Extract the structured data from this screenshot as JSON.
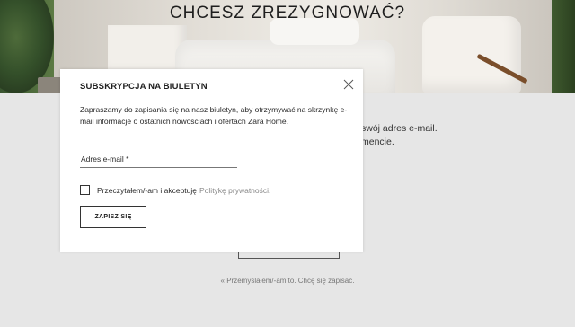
{
  "hero": {
    "title": "CHCESZ ZREZYGNOWAĆ?"
  },
  "background_page": {
    "line1": "swój adres e-mail.",
    "line2": "mencie.",
    "back_link": "« Przemyślałem/-am to. Chcę się zapisać."
  },
  "modal": {
    "title": "SUBSKRYPCJA NA BIULETYN",
    "close_icon": "close-icon",
    "description": "Zapraszamy do zapisania się na nasz biuletyn, aby otrzymywać na skrzynkę e-mail informacje o ostatnich nowościach i ofertach Zara Home.",
    "email_placeholder": "Adres e-mail *",
    "email_value": "",
    "consent_text": "Przeczytałem/-am i akceptuję",
    "consent_link": "Politykę prywatności.",
    "consent_checked": false,
    "submit_label": "ZAPISZ SIĘ"
  },
  "colors": {
    "page_background": "#e6e6e6",
    "modal_background": "#ffffff",
    "text": "#1f1f1f",
    "link_muted": "#888888"
  }
}
